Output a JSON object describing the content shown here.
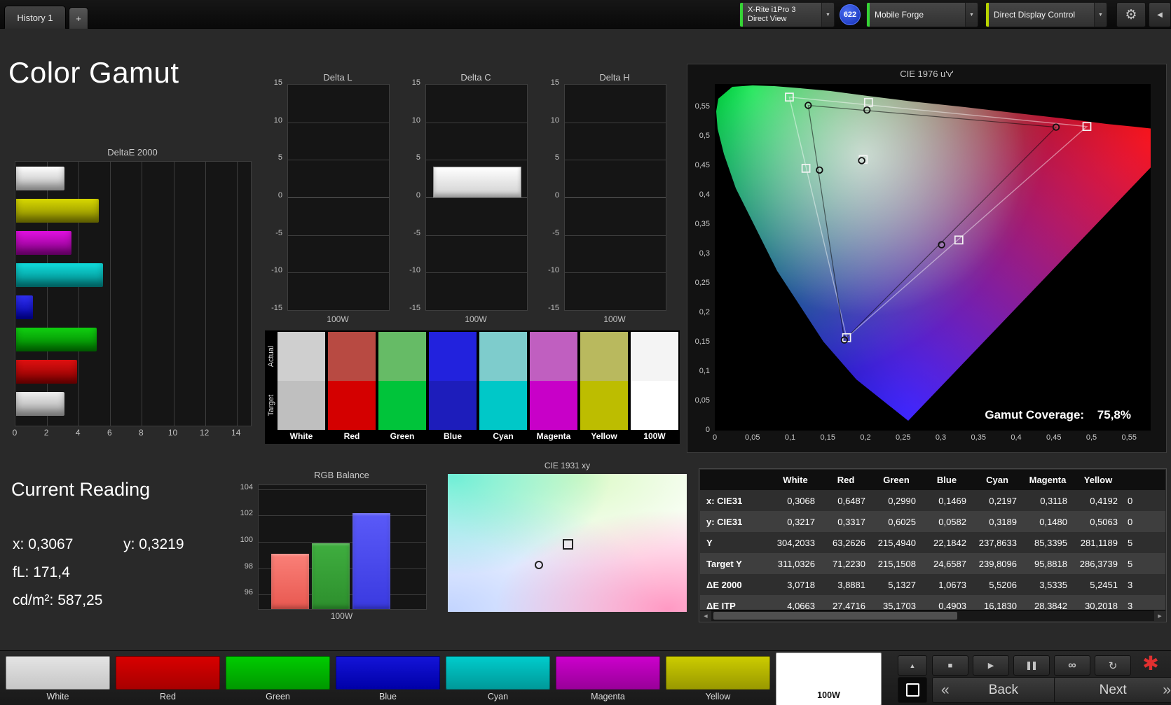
{
  "icons": {
    "dropdown": "▼",
    "gear": "⚙",
    "collapse": "◀",
    "plus_tab": "+",
    "up": "▲",
    "stop": "■",
    "play": "▶",
    "infinity": "∞",
    "loop": "↻",
    "asterisk": "✱",
    "back_chevron": "«",
    "next_chevron": "»",
    "scroll_left": "◀",
    "scroll_right": "▶"
  },
  "top_bar": {
    "history_tab": "History 1",
    "meter_line1": "X-Rite i1Pro 3",
    "meter_line2": "Direct View",
    "meter_status_color": "#35d435",
    "badge": "622",
    "workflow_dropdown": "Mobile Forge",
    "workflow_status_color": "#35d435",
    "display_dropdown": "Direct Display Control",
    "display_status_color": "#b8d400"
  },
  "page_title": "Color Gamut",
  "deltae_chart": {
    "title": "DeltaE 2000",
    "axis_max": 14.9,
    "xticks": [
      0,
      2,
      4,
      6,
      8,
      10,
      12,
      14
    ],
    "bars": [
      {
        "name": "White",
        "value": 3.07,
        "c1": "#ffffff",
        "c2": "#b0b0b0"
      },
      {
        "name": "Yellow",
        "value": 5.25,
        "c1": "#d8d800",
        "c2": "#7f7f00"
      },
      {
        "name": "Magenta",
        "value": 3.53,
        "c1": "#e010e0",
        "c2": "#800080"
      },
      {
        "name": "Cyan",
        "value": 5.52,
        "c1": "#10dcdc",
        "c2": "#008080"
      },
      {
        "name": "Blue",
        "value": 1.07,
        "c1": "#3030f0",
        "c2": "#0000a0"
      },
      {
        "name": "Green",
        "value": 5.13,
        "c1": "#10d010",
        "c2": "#007800"
      },
      {
        "name": "Red",
        "value": 3.89,
        "c1": "#e01010",
        "c2": "#800000"
      },
      {
        "name": "100W",
        "value": 3.07,
        "c1": "#f0f0f0",
        "c2": "#a0a0a0"
      }
    ]
  },
  "delta_charts": [
    {
      "title": "Delta L",
      "xlabel": "100W",
      "value": 0,
      "axis_min": -15,
      "axis_max": 15,
      "yticks": [
        15,
        10,
        5,
        0,
        -5,
        -10,
        -15
      ]
    },
    {
      "title": "Delta C",
      "xlabel": "100W",
      "value": 3.9,
      "axis_min": -15,
      "axis_max": 15,
      "yticks": [
        15,
        10,
        5,
        0,
        -5,
        -10,
        -15
      ]
    },
    {
      "title": "Delta H",
      "xlabel": "100W",
      "value": 0,
      "axis_min": -15,
      "axis_max": 15,
      "yticks": [
        15,
        10,
        5,
        0,
        -5,
        -10,
        -15
      ]
    }
  ],
  "swatches": {
    "row_label_actual": "Actual",
    "row_label_target": "Target",
    "items": [
      {
        "label": "White",
        "actual": "#cfcfcf",
        "target": "#bfbfbf"
      },
      {
        "label": "Red",
        "actual": "#b84a42",
        "target": "#d40000"
      },
      {
        "label": "Green",
        "actual": "#66bb66",
        "target": "#00c43a"
      },
      {
        "label": "Blue",
        "actual": "#2222dd",
        "target": "#1d1dbb"
      },
      {
        "label": "Cyan",
        "actual": "#7ecccc",
        "target": "#00c8c8"
      },
      {
        "label": "Magenta",
        "actual": "#c05fc0",
        "target": "#c800c8"
      },
      {
        "label": "Yellow",
        "actual": "#b9b95e",
        "target": "#bdbd00"
      },
      {
        "label": "100W",
        "actual": "#f4f4f4",
        "target": "#ffffff"
      }
    ]
  },
  "cie1976": {
    "title": "CIE 1976 u'v'",
    "coverage_label": "Gamut Coverage:",
    "coverage_value": "75,8%",
    "xticks": [
      "0",
      "0,05",
      "0,1",
      "0,15",
      "0,2",
      "0,25",
      "0,3",
      "0,35",
      "0,4",
      "0,45",
      "0,5",
      "0,55"
    ],
    "yticks": [
      "0,55",
      "0,5",
      "0,45",
      "0,4",
      "0,35",
      "0,3",
      "0,25",
      "0,2",
      "0,15",
      "0,1",
      "0,05",
      "0"
    ],
    "targets": [
      [
        0.197,
        0.461
      ],
      [
        0.494,
        0.517
      ],
      [
        0.099,
        0.567
      ],
      [
        0.175,
        0.158
      ],
      [
        0.121,
        0.446
      ],
      [
        0.324,
        0.324
      ],
      [
        0.204,
        0.558
      ]
    ],
    "measured": [
      [
        0.195,
        0.459
      ],
      [
        0.453,
        0.516
      ],
      [
        0.124,
        0.553
      ],
      [
        0.172,
        0.154
      ],
      [
        0.139,
        0.443
      ],
      [
        0.301,
        0.316
      ],
      [
        0.202,
        0.545
      ]
    ],
    "target_triangle": [
      [
        0.494,
        0.517
      ],
      [
        0.099,
        0.567
      ],
      [
        0.175,
        0.158
      ]
    ],
    "measured_triangle": [
      [
        0.453,
        0.516
      ],
      [
        0.124,
        0.553
      ],
      [
        0.172,
        0.154
      ]
    ]
  },
  "current_reading": {
    "title": "Current Reading",
    "x_label": "x:",
    "x_value": "0,3067",
    "y_label": "y:",
    "y_value": "0,3219",
    "fl_label": "fL:",
    "fl_value": "171,4",
    "cd_label": "cd/m²:",
    "cd_value": "587,25"
  },
  "rgb_balance": {
    "title": "RGB Balance",
    "xlabel": "100W",
    "axis_min": 94.9,
    "axis_max": 104.3,
    "yticks": [
      104,
      102,
      100,
      98,
      96
    ],
    "bars": [
      {
        "name": "red",
        "value": 99.1,
        "c1": "#fa8078",
        "c2": "#e85850"
      },
      {
        "name": "green",
        "value": 99.9,
        "c1": "#3fae3f",
        "c2": "#2d8f2d"
      },
      {
        "name": "blue",
        "value": 102.2,
        "c1": "#5a5af8",
        "c2": "#3a3ae0"
      }
    ]
  },
  "cie1931": {
    "title": "CIE 1931 xy",
    "target": [
      0.5,
      0.51
    ],
    "measured": [
      0.38,
      0.66
    ]
  },
  "table": {
    "columns": [
      "",
      "White",
      "Red",
      "Green",
      "Blue",
      "Cyan",
      "Magenta",
      "Yellow"
    ],
    "rows": [
      {
        "label": "x: CIE31",
        "values": [
          "0,3068",
          "0,6487",
          "0,2990",
          "0,1469",
          "0,2197",
          "0,3118",
          "0,4192"
        ],
        "partial": "0"
      },
      {
        "label": "y: CIE31",
        "values": [
          "0,3217",
          "0,3317",
          "0,6025",
          "0,0582",
          "0,3189",
          "0,1480",
          "0,5063"
        ],
        "partial": "0"
      },
      {
        "label": "Y",
        "values": [
          "304,2033",
          "63,2626",
          "215,4940",
          "22,1842",
          "237,8633",
          "85,3395",
          "281,1189"
        ],
        "partial": "5"
      },
      {
        "label": "Target Y",
        "values": [
          "311,0326",
          "71,2230",
          "215,1508",
          "24,6587",
          "239,8096",
          "95,8818",
          "286,3739"
        ],
        "partial": "5"
      },
      {
        "label": "ΔE 2000",
        "values": [
          "3,0718",
          "3,8881",
          "5,1327",
          "1,0673",
          "5,5206",
          "3,5335",
          "5,2451"
        ],
        "partial": "3"
      },
      {
        "label": "ΔE ITP",
        "values": [
          "4,0663",
          "27,4716",
          "35,1703",
          "0,4903",
          "16,1830",
          "28,3842",
          "30,2018"
        ],
        "partial": "3"
      }
    ]
  },
  "bottom_patches": [
    {
      "label": "White",
      "c1": "#e4e4e4",
      "c2": "#c6c6c6",
      "selected": false
    },
    {
      "label": "Red",
      "c1": "#d80000",
      "c2": "#a80000",
      "selected": false
    },
    {
      "label": "Green",
      "c1": "#00cc00",
      "c2": "#009900",
      "selected": false
    },
    {
      "label": "Blue",
      "c1": "#1414d8",
      "c2": "#0000a8",
      "selected": false
    },
    {
      "label": "Cyan",
      "c1": "#00cccc",
      "c2": "#009999",
      "selected": false
    },
    {
      "label": "Magenta",
      "c1": "#cc00cc",
      "c2": "#990099",
      "selected": false
    },
    {
      "label": "Yellow",
      "c1": "#cccc00",
      "c2": "#999900",
      "selected": false
    },
    {
      "label": "100W",
      "c1": "#ffffff",
      "c2": "#ffffff",
      "selected": true
    }
  ],
  "controls": {
    "back_label": "Back",
    "next_label": "Next"
  }
}
